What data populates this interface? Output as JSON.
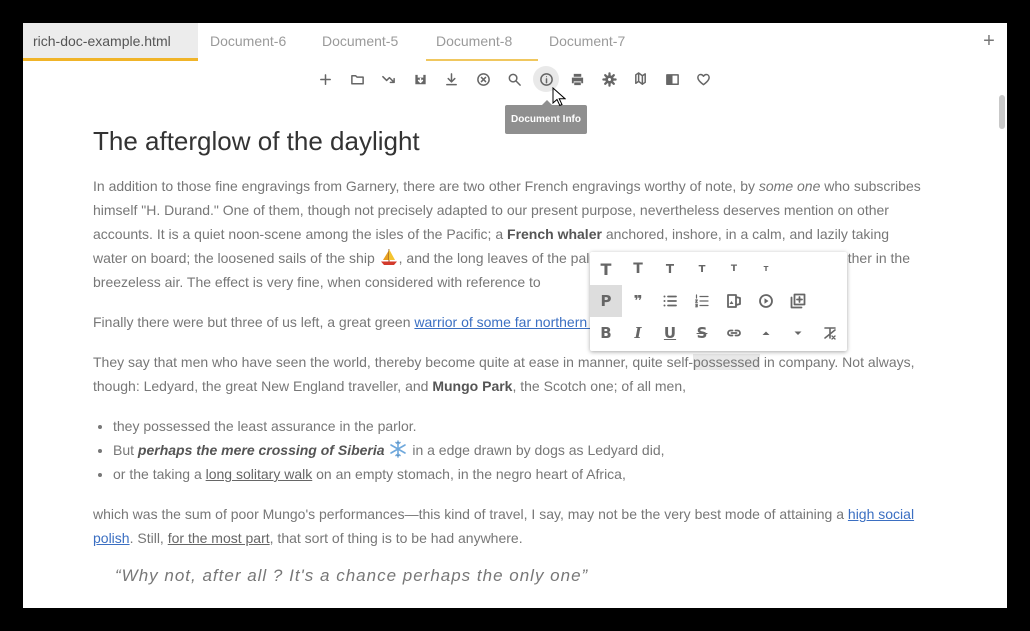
{
  "tabs": [
    {
      "label": "rich-doc-example.html",
      "active": true
    },
    {
      "label": "Document-6"
    },
    {
      "label": "Document-5"
    },
    {
      "label": "Document-8",
      "marked": true
    },
    {
      "label": "Document-7"
    }
  ],
  "tab_add_label": "+",
  "toolbar": {
    "icons": [
      "plus-icon",
      "folder-icon",
      "redirect-icon",
      "save-icon",
      "download-icon",
      "close-circle-icon",
      "search-icon",
      "info-icon",
      "print-icon",
      "settings-icon",
      "map-icon",
      "reader-icon",
      "heart-icon"
    ],
    "tooltip": "Document Info"
  },
  "document": {
    "title": "The afterglow of the daylight",
    "p1": {
      "t1": "In addition to those fine engravings from Garnery, there are two other French engravings worthy of note, by ",
      "em1": "some one",
      "t2": " who subscribes himself \"H. Durand.\" One of them, though not precisely adapted to our present purpose, nevertheless deserves mention on other accounts. It is a quiet noon-scene among the isles of the Pacific; a ",
      "b1": "French whaler",
      "t3": " anchored, inshore, in a calm, and lazily taking water on board; the loosened sails of the ship ",
      "t4": ", and the long leaves of the palms in the background, both drooping together in the breezeless air. The effect is very fine, when considered with reference to"
    },
    "p2": {
      "t1": "Finally there were but three of us left, a great green ",
      "link1": "warrior of some far northern horde"
    },
    "p3": {
      "t1": "They say that men who have seen the world, thereby become quite at ease in manner, quite self-",
      "hl": "possessed",
      "t2": " in company. Not always, though: Ledyard, the great New England traveller, and ",
      "b1": "Mungo Park",
      "t3": ", the Scotch one; of all men,"
    },
    "list": {
      "item1": "they possessed the least assurance in the parlor.",
      "item2_t1": "But ",
      "item2_bi": "perhaps the mere crossing of Siberia",
      "item2_t2": " in a edge drawn by dogs as Ledyard did,",
      "item3_t1": "or the taking a ",
      "item3_u": "long solitary walk",
      "item3_t2": " on an empty stomach, in the negro heart of Africa,"
    },
    "p4": {
      "t1": "which was the sum of poor Mungo's performances—this kind of travel, I say, may not be the very best mode of attaining a ",
      "link1": "high social polish",
      "t2": ". Still, ",
      "u1": "for the most part",
      "t3": ", that sort of thing is to be had anywhere."
    },
    "quote": "“Why not, after all ? It's a chance perhaps the only one”"
  },
  "format_toolbar": {
    "heading_glyph": "T",
    "paragraph_glyph": "P",
    "bold_glyph": "B",
    "italic_glyph": "I",
    "underline_glyph": "U",
    "strike_glyph": "S",
    "quote_glyph": "❞"
  }
}
